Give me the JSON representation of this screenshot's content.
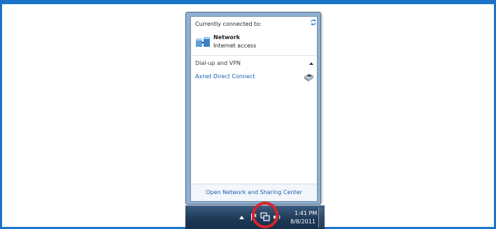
{
  "flyout": {
    "header": "Currently connected to:",
    "network": {
      "name": "Network",
      "status": "Internet access"
    },
    "section_header": "Dial-up and VPN",
    "vpn_connection": "Axnet Direct Connect",
    "footer_link": "Open Network and Sharing Center"
  },
  "taskbar": {
    "time": "1:41 PM",
    "date": "8/8/2011"
  },
  "colors": {
    "frame_border": "#1b73c9",
    "link": "#1a5eb4",
    "highlight_circle": "#d8242a"
  },
  "icons": [
    "refresh-icon",
    "network-icon",
    "collapse-chevron-icon",
    "phone-modem-icon",
    "show-hidden-icons-arrow-icon",
    "action-center-flag-icon",
    "network-tray-icon",
    "volume-icon"
  ]
}
